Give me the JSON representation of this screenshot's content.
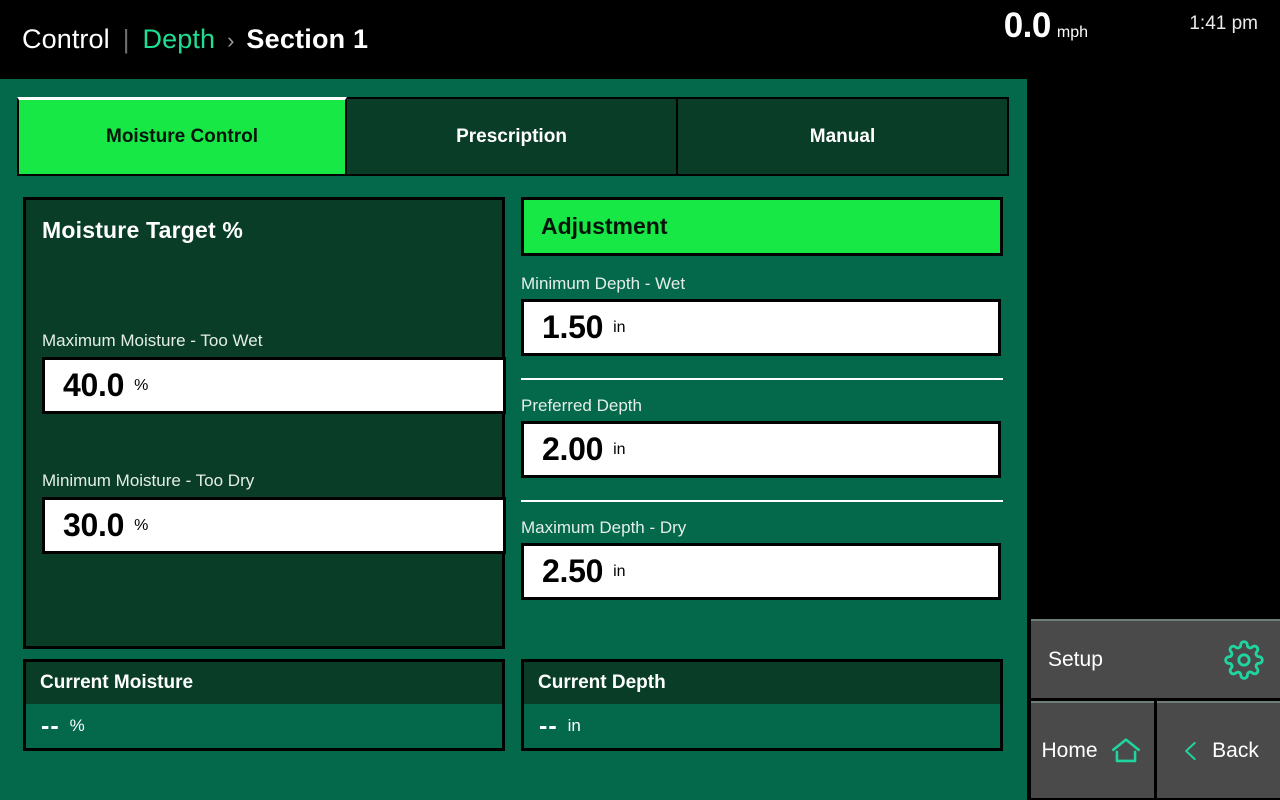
{
  "header": {
    "breadcrumb_root": "Control",
    "breadcrumb_separator": "|",
    "breadcrumb_link": "Depth",
    "breadcrumb_chevron": "›",
    "breadcrumb_current": "Section 1",
    "speed_value": "0.0",
    "speed_unit": "mph",
    "time": "1:41 pm"
  },
  "tabs": [
    {
      "label": "Moisture Control",
      "active": true
    },
    {
      "label": "Prescription",
      "active": false
    },
    {
      "label": "Manual",
      "active": false
    }
  ],
  "moisture_panel": {
    "title": "Moisture Target %",
    "fields": [
      {
        "label": "Maximum Moisture - Too Wet",
        "value": "40.0",
        "unit": "%"
      },
      {
        "label": "Minimum Moisture - Too Dry",
        "value": "30.0",
        "unit": "%"
      }
    ]
  },
  "adjustment_panel": {
    "title": "Adjustment",
    "fields": [
      {
        "label": "Minimum Depth - Wet",
        "value": "1.50",
        "unit": "in"
      },
      {
        "label": "Preferred Depth",
        "value": "2.00",
        "unit": "in"
      },
      {
        "label": "Maximum Depth - Dry",
        "value": "2.50",
        "unit": "in"
      }
    ]
  },
  "status_cards": [
    {
      "title": "Current Moisture",
      "value": "--",
      "unit": "%"
    },
    {
      "title": "Current Depth",
      "value": "--",
      "unit": "in"
    }
  ],
  "sidebar": {
    "setup_label": "Setup",
    "home_label": "Home",
    "back_label": "Back"
  },
  "colors": {
    "accent_green": "#17e845",
    "panel_dark": "#0a3d28",
    "stage_green": "#04684a",
    "teal_link": "#1fde92",
    "button_gray": "#4a4a4a"
  }
}
